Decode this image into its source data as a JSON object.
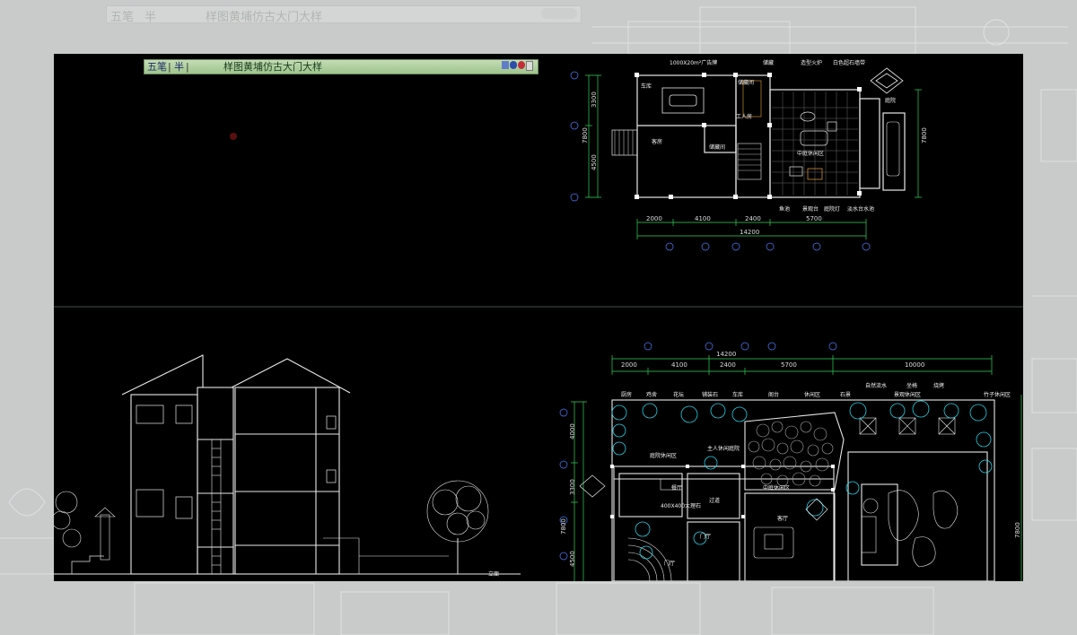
{
  "ghost_ime": {
    "mode": "五笔",
    "width": "半",
    "text": "样图黄埔仿古大门大样"
  },
  "ime": {
    "mode": "五笔",
    "width": "半",
    "separator": "|",
    "text": "样图黄埔仿古大门大样",
    "icons": [
      "keyboard-icon",
      "moon-icon",
      "softkey-icon",
      "menu-icon"
    ]
  },
  "top_plan": {
    "labels": {
      "rooms": [
        "车库",
        "客房",
        "工人房",
        "储藏间",
        "储藏间",
        "中庭休闲区",
        "庭院",
        "主卧"
      ],
      "top_notes": [
        "1000X20m²广告牌",
        "储藏",
        "造型火炉",
        "白色超石墙带"
      ],
      "bottom_notes": [
        "鱼池",
        "景观台",
        "庭院灯",
        "淡水台水池"
      ]
    },
    "dims_bottom": [
      "2000",
      "4100",
      "2400",
      "5700"
    ],
    "dim_total": "14200",
    "dims_left": [
      "3300",
      "7800",
      "4500"
    ],
    "dim_right": "7800"
  },
  "bottom_plan": {
    "dims_top": [
      "2000",
      "4100",
      "2400",
      "5700",
      "10000"
    ],
    "dim_total": "14200",
    "dims_left": [
      "4000",
      "3300",
      "7800",
      "4500"
    ],
    "top_labels": [
      "厨房",
      "鸡舍",
      "花坛",
      "铺装石",
      "车库",
      "阁台",
      "休闲区",
      "石景",
      "自然流水",
      "坐椅",
      "烧烤",
      "景观休闲区",
      "竹子休闲区"
    ],
    "room_labels": [
      "庭院休闲区",
      "主人休闲庭院",
      "餐厅",
      "客厅",
      "400X400大理石",
      "门厅",
      "门厅",
      "过道",
      "中庭休闲区"
    ],
    "right_dim": "7800"
  },
  "section": {
    "label": "立面"
  },
  "colors": {
    "canvas": "#000000",
    "lines": "#e8e8e8",
    "cyan": "#22d3e6",
    "dim_green": "#2fd45c",
    "dim_blue": "#4f7dff"
  }
}
